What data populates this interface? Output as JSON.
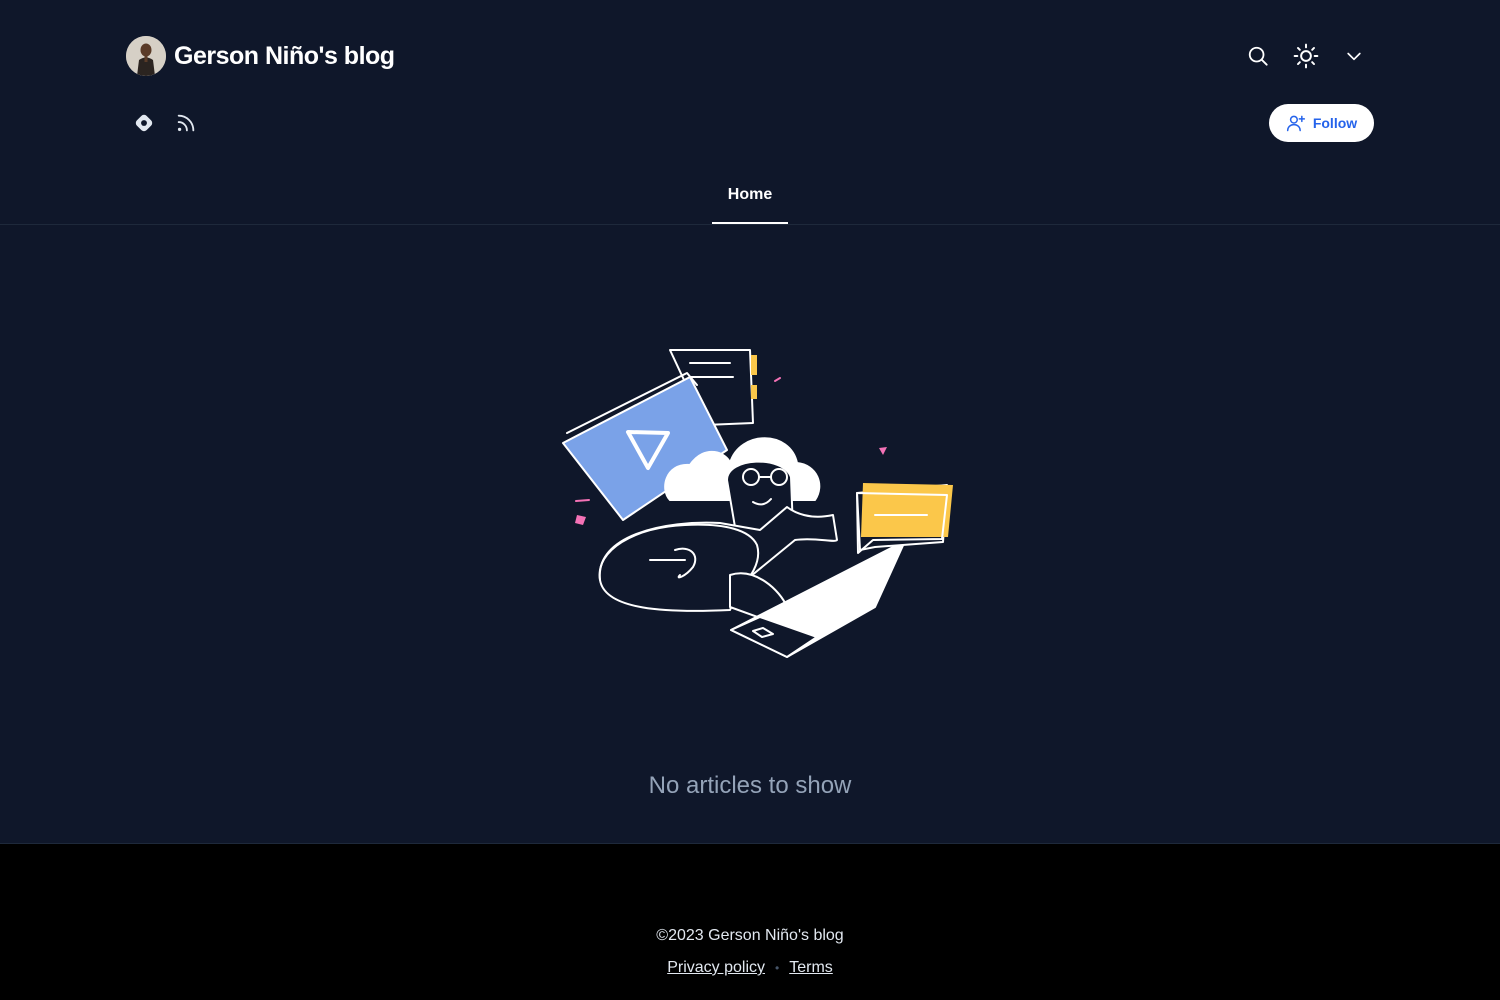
{
  "header": {
    "blog_title": "Gerson Niño's blog",
    "avatar_alt": "Gerson Niño",
    "icons": {
      "search": "search-icon",
      "theme": "sun-icon",
      "menu": "chevron-down-icon"
    }
  },
  "social": [
    {
      "name": "hashnode-icon"
    },
    {
      "name": "rss-icon"
    }
  ],
  "follow": {
    "label": "Follow",
    "icon": "user-plus-icon"
  },
  "tabs": [
    {
      "label": "Home",
      "active": true
    }
  ],
  "main": {
    "empty_message": "No articles to show"
  },
  "footer": {
    "copyright": "©2023 Gerson Niño's blog",
    "links": [
      "Privacy policy",
      "Terms"
    ]
  },
  "colors": {
    "background": "#0f172a",
    "footer_bg": "#000000",
    "accent": "#2563eb",
    "muted_text": "#94a3b8",
    "illustration_blue": "#7aa2e8",
    "illustration_yellow": "#fbc74a",
    "illustration_pink": "#f472b6"
  }
}
